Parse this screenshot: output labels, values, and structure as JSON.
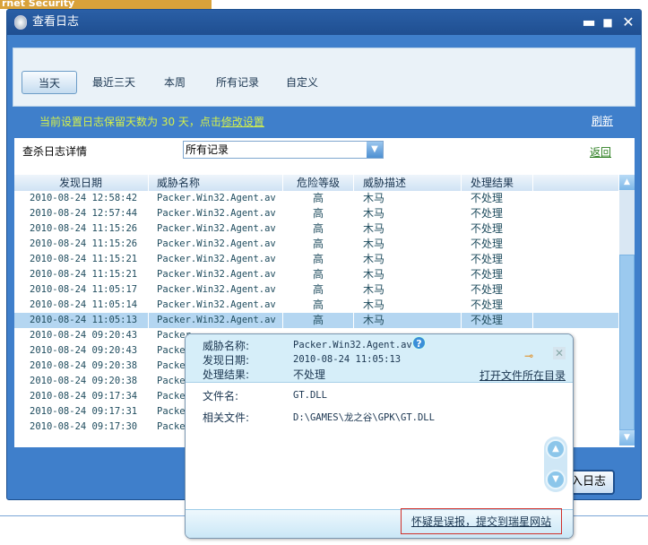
{
  "background_app": {
    "title_fragment": "rnet Security"
  },
  "window": {
    "title": "查看日志",
    "minimize": "▬",
    "maximize": "■",
    "close": "✕"
  },
  "tabs": [
    {
      "label": "当天",
      "active": true
    },
    {
      "label": "最近三天"
    },
    {
      "label": "本周"
    },
    {
      "label": "所有记录"
    },
    {
      "label": "自定义"
    }
  ],
  "info": {
    "prefix": "当前设置日志保留天数为 30 天，点击",
    "link": "修改设置"
  },
  "refresh": "刷新",
  "panel": {
    "title": "查杀日志详情",
    "filter_value": "所有记录",
    "back": "返回"
  },
  "table": {
    "columns": [
      "发现日期",
      "威胁名称",
      "危险等级",
      "威胁描述",
      "处理结果",
      ""
    ],
    "rows": [
      [
        "2010-08-24 12:58:42",
        "Packer.Win32.Agent.av",
        "高",
        "木马",
        "不处理"
      ],
      [
        "2010-08-24 12:57:44",
        "Packer.Win32.Agent.av",
        "高",
        "木马",
        "不处理"
      ],
      [
        "2010-08-24 11:15:26",
        "Packer.Win32.Agent.av",
        "高",
        "木马",
        "不处理"
      ],
      [
        "2010-08-24 11:15:26",
        "Packer.Win32.Agent.av",
        "高",
        "木马",
        "不处理"
      ],
      [
        "2010-08-24 11:15:21",
        "Packer.Win32.Agent.av",
        "高",
        "木马",
        "不处理"
      ],
      [
        "2010-08-24 11:15:21",
        "Packer.Win32.Agent.av",
        "高",
        "木马",
        "不处理"
      ],
      [
        "2010-08-24 11:05:17",
        "Packer.Win32.Agent.av",
        "高",
        "木马",
        "不处理"
      ],
      [
        "2010-08-24 11:05:14",
        "Packer.Win32.Agent.av",
        "高",
        "木马",
        "不处理"
      ],
      [
        "2010-08-24 11:05:13",
        "Packer.Win32.Agent.av",
        "高",
        "木马",
        "不处理"
      ],
      [
        "2010-08-24 09:20:43",
        "Packer",
        "",
        "",
        ""
      ],
      [
        "2010-08-24 09:20:43",
        "Packe",
        "",
        "",
        ""
      ],
      [
        "2010-08-24 09:20:38",
        "Packe",
        "",
        "",
        ""
      ],
      [
        "2010-08-24 09:20:38",
        "Packe",
        "",
        "",
        ""
      ],
      [
        "2010-08-24 09:17:34",
        "Packe",
        "",
        "",
        ""
      ],
      [
        "2010-08-24 09:17:31",
        "Packe",
        "",
        "",
        ""
      ],
      [
        "2010-08-24 09:17:30",
        "Packe",
        "",
        "",
        ""
      ]
    ],
    "selected_row": 8
  },
  "import_button": "入日志",
  "popup": {
    "threat_name_label": "威胁名称:",
    "threat_name": "Packer.Win32.Agent.av",
    "date_label": "发现日期:",
    "date": "2010-08-24 11:05:13",
    "result_label": "处理结果:",
    "result": "不处理",
    "open_dir": "打开文件所在目录",
    "file_label": "文件名:",
    "file": "GT.DLL",
    "related_label": "相关文件:",
    "related": "D:\\GAMES\\龙之谷\\GPK\\GT.DLL",
    "help": "?",
    "report": "怀疑是误报，提交到瑞星网站"
  },
  "colors": {
    "window_blue": "#3f7fcb",
    "title_bar": "#1f4f91",
    "info_text": "#d4f04a",
    "back_link": "#2a7d1e",
    "selected_row": "#b4d6f1",
    "report_border": "#d0302a"
  }
}
